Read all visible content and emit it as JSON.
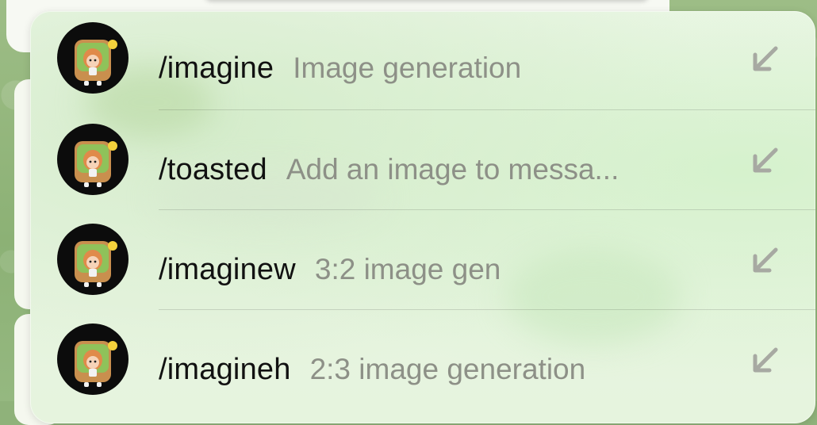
{
  "suggestions": [
    {
      "command": "/imagine",
      "description": "Image generation",
      "icon": "insert-arrow-icon"
    },
    {
      "command": "/toasted",
      "description": "Add an image to messa...",
      "icon": "insert-arrow-icon"
    },
    {
      "command": "/imaginew",
      "description": "3:2 image gen",
      "icon": "insert-arrow-icon"
    },
    {
      "command": "/imagineh",
      "description": "2:3 image generation",
      "icon": "insert-arrow-icon"
    }
  ],
  "colors": {
    "command_text": "#111111",
    "description_text": "#8d9087",
    "arrow": "#a7a9a2",
    "avatar_background": "#0c0c0c",
    "toast_green": "#8fc25a"
  }
}
